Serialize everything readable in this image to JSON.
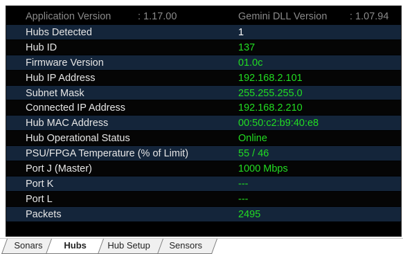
{
  "header": {
    "app_version_label": "Application Version",
    "app_version_value": ": 1.17.00",
    "dll_version_label": "Gemini DLL Version",
    "dll_version_value": ": 1.07.94"
  },
  "rows": [
    {
      "label": "Hubs Detected",
      "value": "1",
      "color": "#ffffff"
    },
    {
      "label": "Hub ID",
      "value": "137",
      "color": "#22dd22"
    },
    {
      "label": "Firmware Version",
      "value": "01.0c",
      "color": "#22dd22"
    },
    {
      "label": "Hub IP Address",
      "value": "192.168.2.101",
      "color": "#22dd22"
    },
    {
      "label": "Subnet Mask",
      "value": "255.255.255.0",
      "color": "#22dd22"
    },
    {
      "label": "Connected IP Address",
      "value": "192.168.2.210",
      "color": "#22dd22"
    },
    {
      "label": "Hub MAC Address",
      "value": "00:50:c2:b9:40:e8",
      "color": "#22dd22"
    },
    {
      "label": "Hub Operational Status",
      "value": "Online",
      "color": "#22dd22"
    },
    {
      "label": "PSU/FPGA Temperature (% of Limit)",
      "value": "55 / 46",
      "color": "#22dd22"
    },
    {
      "label": "Port J (Master)",
      "value": "1000 Mbps",
      "color": "#22dd22"
    },
    {
      "label": "Port K",
      "value": "---",
      "color": "#22dd22"
    },
    {
      "label": "Port L",
      "value": "---",
      "color": "#22dd22"
    },
    {
      "label": "Packets",
      "value": "2495",
      "color": "#22dd22"
    }
  ],
  "tabs": [
    {
      "label": "Sonars",
      "active": false
    },
    {
      "label": "Hubs",
      "active": true
    },
    {
      "label": "Hub Setup",
      "active": false
    },
    {
      "label": "Sensors",
      "active": false
    }
  ]
}
